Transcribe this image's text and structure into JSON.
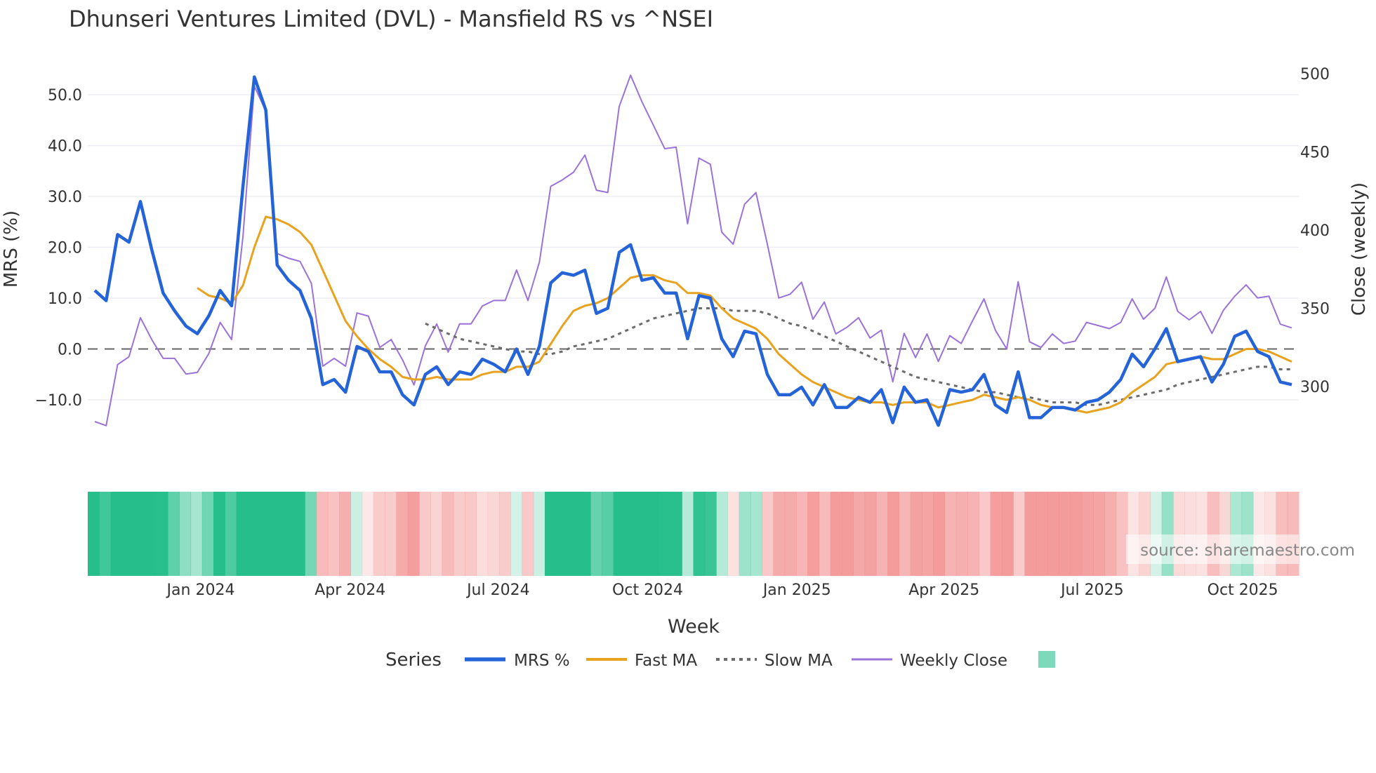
{
  "chart_data": {
    "type": "line",
    "title": "Dhunseri Ventures Limited (DVL) - Mansfield RS vs ^NSEI",
    "xlabel": "Week",
    "ylabel": "MRS (%)",
    "y2label": "Close (weekly)",
    "ylim": [
      -17.5,
      55
    ],
    "y2lim": [
      263,
      510
    ],
    "y_ticks": [
      "50.0",
      "40.0",
      "30.0",
      "20.0",
      "10.0",
      "0.0",
      "−10.0"
    ],
    "y_tick_values": [
      50,
      40,
      30,
      20,
      10,
      0,
      -10
    ],
    "y2_ticks": [
      "500",
      "450",
      "400",
      "350",
      "300"
    ],
    "y2_tick_values": [
      500,
      450,
      400,
      350,
      300
    ],
    "x_ticks": [
      "Jan 2024",
      "Apr 2024",
      "Jul 2024",
      "Oct 2024",
      "Jan 2025",
      "Apr 2025",
      "Jul 2025",
      "Oct 2025"
    ],
    "x_tick_weeks": [
      9.3,
      22.4,
      35.4,
      48.5,
      61.6,
      74.5,
      87.5,
      100.7
    ],
    "grid": true,
    "zero_line": "dashed",
    "legend": {
      "title": "Series",
      "placement": "bottom-center",
      "entries": [
        "MRS %",
        "Fast MA",
        "Slow MA",
        "Weekly Close"
      ]
    },
    "source": "source: sharemaestro.com",
    "colors": {
      "mrs": "#2563d9",
      "fast": "#e8a21e",
      "slow": "#6b6b6b",
      "close": "#9b72d9",
      "pos": "#26bf8c",
      "neg": "#f28b8b"
    },
    "series": [
      {
        "name": "MRS %",
        "axis": "left",
        "values": [
          11.5,
          9.5,
          22.5,
          21,
          29,
          19.5,
          11,
          7.5,
          4.5,
          3,
          6.5,
          11.5,
          8.5,
          32,
          53.5,
          47,
          16.5,
          13.5,
          11.5,
          6,
          -7,
          -6,
          -8.5,
          0.5,
          -0.5,
          -4.5,
          -4.5,
          -9,
          -11,
          -5,
          -3.5,
          -7,
          -4.5,
          -5,
          -2,
          -3,
          -4.5,
          0,
          -5,
          0.5,
          13,
          15,
          14.5,
          15.5,
          7,
          8,
          19,
          20.5,
          13.5,
          14,
          11,
          11,
          2,
          10.5,
          10,
          2,
          -1.5,
          3.5,
          3,
          -5,
          -9,
          -9,
          -7.5,
          -11,
          -7,
          -11.5,
          -11.5,
          -9.5,
          -10.5,
          -8,
          -14.5,
          -7.5,
          -10.5,
          -10,
          -15,
          -8,
          -8.5,
          -8,
          -5,
          -11,
          -12.5,
          -4.5,
          -13.5,
          -13.5,
          -11.5,
          -11.5,
          -12,
          -10.5,
          -10,
          -8.5,
          -6,
          -1,
          -3.5,
          0,
          4,
          -2.5,
          -2,
          -1.5,
          -6.5,
          -3,
          2.5,
          3.5,
          -0.5,
          -1.5,
          -6.5,
          -7
        ]
      },
      {
        "name": "Fast MA",
        "axis": "left",
        "values": [
          null,
          null,
          null,
          null,
          null,
          null,
          null,
          null,
          null,
          12,
          10.5,
          10,
          9,
          12.5,
          20,
          26,
          25.5,
          24.5,
          23,
          20.5,
          15.5,
          10.5,
          5.5,
          2.5,
          0,
          -2,
          -3.5,
          -5.5,
          -6,
          -6,
          -5.5,
          -6,
          -6,
          -6,
          -5,
          -4.5,
          -4.5,
          -3.5,
          -3.5,
          -2.5,
          1,
          4.5,
          7.5,
          8.5,
          9,
          10,
          12,
          14,
          14.5,
          14.5,
          13.5,
          13,
          11,
          11,
          10.5,
          8,
          6,
          5,
          4,
          2,
          -1,
          -3,
          -5,
          -6.5,
          -7.5,
          -8.5,
          -9.5,
          -10,
          -10.5,
          -10.5,
          -11,
          -10.5,
          -10.5,
          -10.5,
          -11.5,
          -11,
          -10.5,
          -10,
          -9,
          -9.5,
          -10,
          -9.5,
          -10,
          -11,
          -11.5,
          -11.5,
          -12,
          -12.5,
          -12,
          -11.5,
          -10.5,
          -8.5,
          -7,
          -5.5,
          -3,
          -2.5,
          -2,
          -1.5,
          -2,
          -2,
          -1,
          0,
          0,
          -0.5,
          -1.5,
          -2.5
        ]
      },
      {
        "name": "Slow MA",
        "axis": "left",
        "values": [
          null,
          null,
          null,
          null,
          null,
          null,
          null,
          null,
          null,
          null,
          null,
          null,
          null,
          null,
          null,
          null,
          null,
          null,
          null,
          null,
          null,
          null,
          null,
          null,
          null,
          null,
          null,
          null,
          null,
          5,
          4,
          3,
          2,
          1.5,
          1,
          0.5,
          0,
          -0.5,
          -0.5,
          -1,
          -1,
          -0.5,
          0.5,
          1,
          1.5,
          2,
          3,
          4,
          5,
          6,
          6.5,
          7,
          7.5,
          8,
          8,
          8,
          7.5,
          7.5,
          7.5,
          7,
          6,
          5,
          4.5,
          3.5,
          2.5,
          1.5,
          0.5,
          -0.5,
          -1.5,
          -2.5,
          -3.5,
          -4.5,
          -5.5,
          -6,
          -6.5,
          -7,
          -7.5,
          -8,
          -8.5,
          -8.5,
          -9,
          -9.5,
          -9.5,
          -10,
          -10.5,
          -10.5,
          -10.5,
          -11,
          -11,
          -10.5,
          -10,
          -9.5,
          -9,
          -8.5,
          -8,
          -7,
          -6.5,
          -6,
          -5.5,
          -5,
          -4.5,
          -4,
          -3.5,
          -3.5,
          -4,
          -4
        ]
      },
      {
        "name": "Weekly Close",
        "axis": "right",
        "values": [
          277.6,
          275,
          314,
          319,
          344,
          330,
          318,
          318,
          308,
          309,
          321,
          341,
          330,
          396,
          492,
          476,
          385,
          382,
          380,
          366,
          313,
          318,
          313,
          347,
          345,
          325,
          330,
          317,
          301,
          326,
          340,
          322,
          340,
          340,
          351.5,
          355,
          355,
          374.5,
          355,
          379.5,
          428,
          432,
          437,
          448,
          425.5,
          424,
          479,
          499,
          482,
          467,
          452,
          453,
          404,
          446,
          442,
          398.6,
          391,
          416.5,
          424,
          391,
          356.6,
          359,
          366.7,
          343,
          354,
          333.6,
          338,
          344,
          331,
          336,
          303,
          334,
          318.5,
          333.6,
          316,
          332.5,
          327.5,
          342,
          356,
          336,
          324,
          367,
          328.6,
          325,
          333.6,
          327.5,
          329,
          341,
          339,
          337,
          341,
          356,
          343,
          350,
          370,
          348,
          342.6,
          348,
          334,
          348.7,
          357.7,
          365,
          356.6,
          357.7,
          339.8,
          337.5
        ]
      }
    ]
  }
}
